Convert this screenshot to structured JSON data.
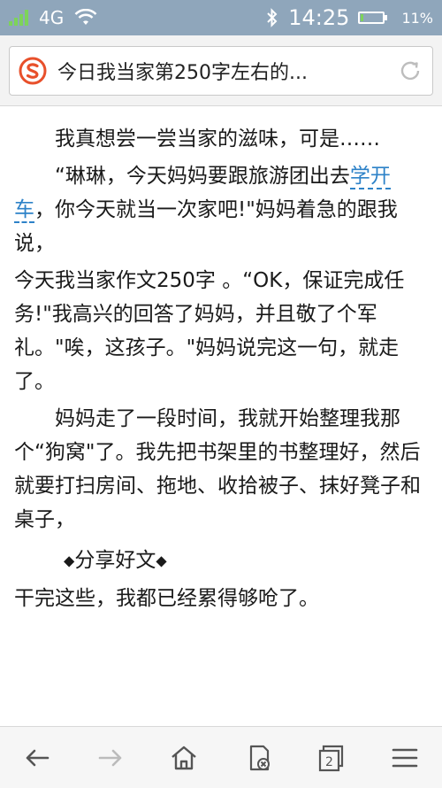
{
  "status_bar": {
    "network": "4G",
    "time": "14:25",
    "battery_percent": "11%",
    "battery_level": 0.11,
    "signal_color": "#7dd35a",
    "icons": [
      "signal-icon",
      "wifi-icon",
      "bluetooth-icon",
      "battery-icon"
    ]
  },
  "address_bar": {
    "title": "今日我当家第250字左右的...",
    "logo": "sogou-logo-icon",
    "refresh": "refresh-icon",
    "brand_color": "#e8502b"
  },
  "article": {
    "p1": "我真想尝一尝当家的滋味，可是……",
    "p2_before_link": "“琳琳，今天妈妈要跟旅游团出去",
    "p2_link": "学开车",
    "p2_after_link": "，你今天就当一次家吧!\"妈妈着急的跟我说，",
    "p3": "今天我当家作文250字 。“OK，保证完成任务!\"我高兴的回答了妈妈，并且敬了个军礼。\"唉，这孩子。\"妈妈说完这一句，就走了。",
    "p4": "妈妈走了一段时间，我就开始整理我那个“狗窝\"了。我先把书架里的书整理好，然后就要打扫房间、拖地、收拾被子、抹好凳子和桌子，",
    "share_label": "分享好文",
    "p5": "干完这些，我都已经累得够呛了。",
    "link_color": "#2d82c8"
  },
  "toolbar": {
    "back": "back-arrow-icon",
    "forward": "forward-arrow-icon",
    "home": "home-icon",
    "close_page": "close-page-icon",
    "tabs": "tabs-icon",
    "tab_count": "2",
    "menu": "menu-icon"
  }
}
